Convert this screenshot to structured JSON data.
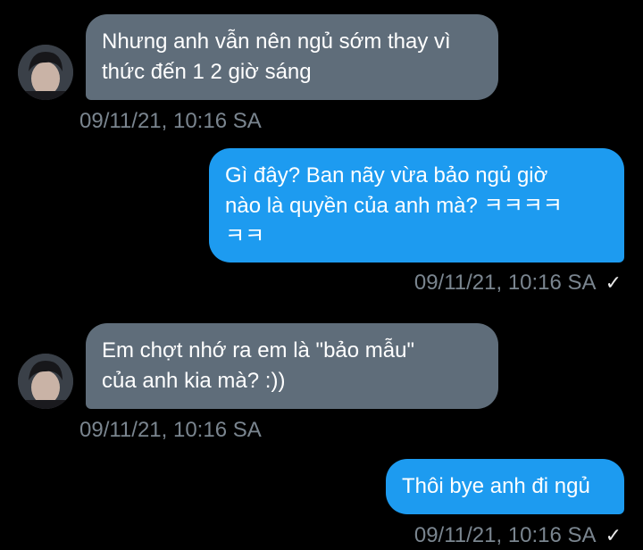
{
  "messages": [
    {
      "direction": "in",
      "text": "Nhưng anh vẫn nên ngủ sớm thay vì\nthức đến 1 2 giờ sáng",
      "timestamp": "09/11/21, 10:16 SA"
    },
    {
      "direction": "out",
      "text": "Gì đây? Ban nãy vừa bảo ngủ giờ\nnào là quyền của anh mà? ㅋㅋㅋㅋ\nㅋㅋ",
      "timestamp": "09/11/21, 10:16 SA",
      "status_icon": "checkmark-icon",
      "status_glyph": "✓"
    },
    {
      "direction": "in",
      "text": "Em chợt nhớ ra em là \"bảo mẫu\"\ncủa anh kia mà? :))",
      "timestamp": "09/11/21, 10:16 SA"
    },
    {
      "direction": "out",
      "text": "Thôi bye anh đi ngủ",
      "timestamp": "09/11/21, 10:16 SA",
      "status_icon": "checkmark-icon",
      "status_glyph": "✓"
    }
  ],
  "colors": {
    "background": "#000000",
    "incoming_bubble": "#5f6d7a",
    "outgoing_bubble": "#1d9bf0",
    "timestamp": "#7a858f"
  }
}
